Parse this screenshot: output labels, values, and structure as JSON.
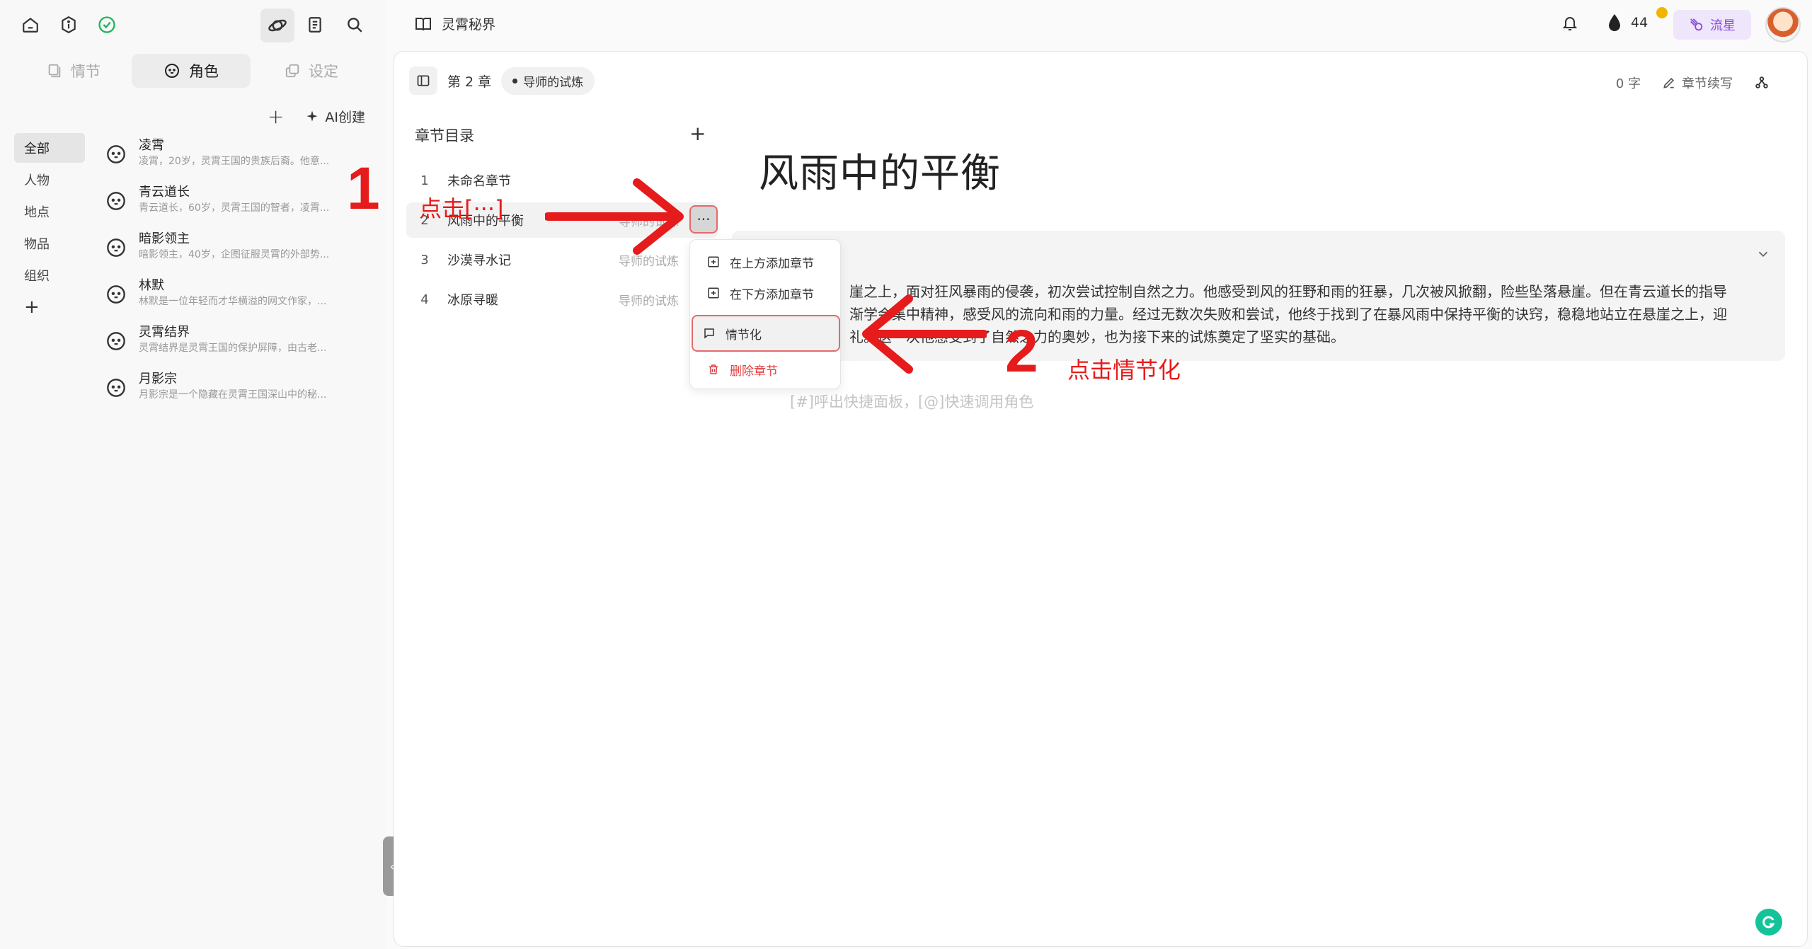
{
  "sidebar": {
    "tabs": [
      {
        "label": "情节",
        "icon": "book-icon"
      },
      {
        "label": "角色",
        "icon": "face-icon"
      },
      {
        "label": "设定",
        "icon": "layers-icon"
      }
    ],
    "add_label": "+",
    "ai_create_label": "AI创建",
    "categories": [
      "全部",
      "人物",
      "地点",
      "物品",
      "组织"
    ],
    "categories_add": "+",
    "characters": [
      {
        "name": "凌霄",
        "desc": "凌霄，20岁，灵霄王国的贵族后裔。他意..."
      },
      {
        "name": "青云道长",
        "desc": "青云道长，60岁，灵霄王国的智者，凌霄..."
      },
      {
        "name": "暗影领主",
        "desc": "暗影领主，40岁，企图征服灵霄的外部势..."
      },
      {
        "name": "林默",
        "desc": "林默是一位年轻而才华横溢的网文作家，..."
      },
      {
        "name": "灵霄结界",
        "desc": "灵霄结界是灵霄王国的保护屏障，由古老..."
      },
      {
        "name": "月影宗",
        "desc": "月影宗是一个隐藏在灵霄王国深山中的秘..."
      }
    ],
    "collapse_label": "‹"
  },
  "header": {
    "book_title": "灵霄秘界",
    "ink_count": "44",
    "pro_label": "流星"
  },
  "editor": {
    "chapter_label": "第 2 章",
    "volume_tag": "导师的试炼",
    "word_count": "0 字",
    "continue_label": "章节续写",
    "toc_title": "章节目录",
    "toc_add": "+",
    "chapters": [
      {
        "num": "1",
        "name": "未命名章节",
        "sub": ""
      },
      {
        "num": "2",
        "name": "风雨中的平衡",
        "sub": "导师的试炼"
      },
      {
        "num": "3",
        "name": "沙漠寻水记",
        "sub": "导师的试炼"
      },
      {
        "num": "4",
        "name": "冰原寻暖",
        "sub": "导师的试炼"
      }
    ],
    "more_label": "···",
    "menu": {
      "add_above": "在上方添加章节",
      "add_below": "在下方添加章节",
      "plotify": "情节化",
      "delete": "删除章节"
    },
    "title": "风雨中的平衡",
    "summary_line1": "崖之上，面对狂风暴雨的侵袭，初次尝试控制自然之力。他感受到风的狂野和雨的狂暴，几次被风掀翻，险些坠落悬崖。但在青云道长的指导",
    "summary_line2": "渐学会集中精神，感受风的流向和雨的力量。经过无数次失败和尝试，他终于找到了在暴风雨中保持平衡的诀窍，稳稳地站立在悬崖之上，迎",
    "summary_line3": "礼。这一次他感受到了自然之力的奥妙，也为接下来的试炼奠定了坚实的基础。",
    "placeholder": "[#]呼出快捷面板，[@]快速调用角色"
  },
  "annotations": {
    "step1_num": "1",
    "step1_text": "点击[···]",
    "step2_num": "2",
    "step2_text": "点击情节化",
    "color": "#e61b1b"
  },
  "colors": {
    "accent_purple": "#8a4be0",
    "danger": "#e03c3c",
    "ink_badge": "#f2b400",
    "grammarly": "#15c39a"
  }
}
